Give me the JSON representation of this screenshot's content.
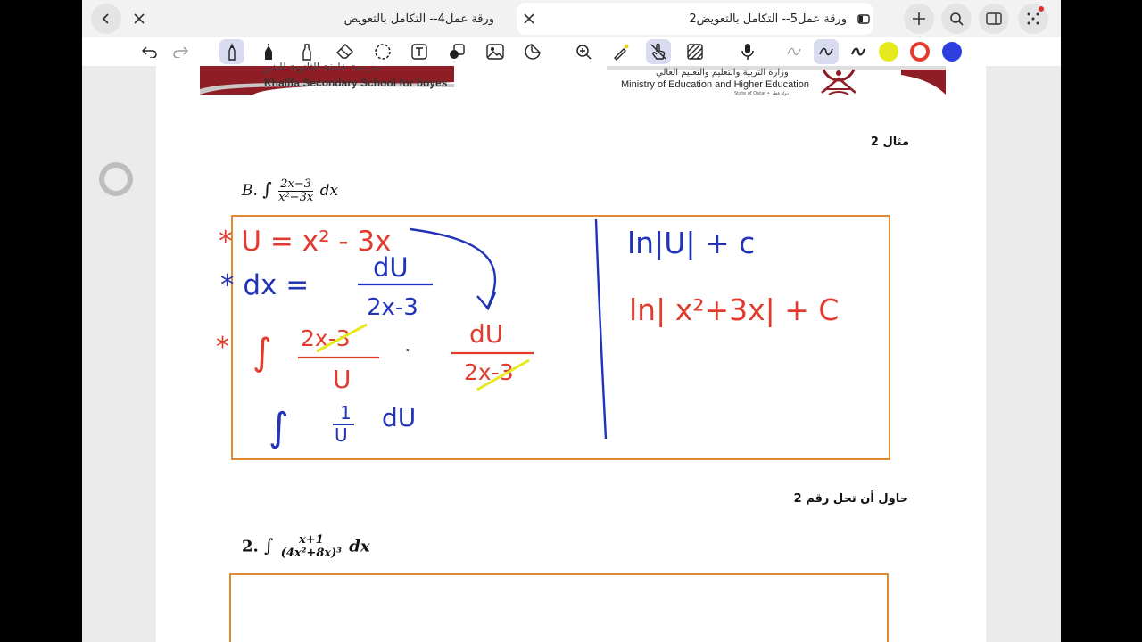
{
  "tabs": [
    {
      "title": "ورقة عمل4-- التكامل بالتعويض",
      "active": false
    },
    {
      "title": "ورقة عمل5-- التكامل بالتعويض2",
      "active": true
    }
  ],
  "icons": {
    "back": "chevron-left-icon",
    "new_tab": "plus-icon",
    "search": "search-icon",
    "sidebar": "sidebar-icon",
    "more": "grid-dots-icon",
    "undo": "undo-icon",
    "redo": "redo-icon",
    "pen": "pen-icon",
    "marker": "marker-icon",
    "highlighter": "highlighter-icon",
    "eraser": "eraser-icon",
    "lasso": "lasso-icon",
    "text": "text-box-icon",
    "shapes": "shapes-icon",
    "image": "image-icon",
    "sticker": "sticker-icon",
    "zoom": "zoom-icon",
    "laser": "laser-pointer-icon",
    "touch": "hand-touch-icon",
    "hatch": "hatch-icon",
    "mic": "microphone-icon"
  },
  "colors": {
    "yellow": "#e6ea1d",
    "red": "#e63a2e",
    "blue": "#2c3ee0",
    "ink_red": "#e23b2e",
    "ink_blue": "#2233b8",
    "box": "#e08a33"
  },
  "header": {
    "school_en": "Khalifa Secondary School for boyes",
    "school_ar": "مدرسة خليفة الثانوية للبنين",
    "ministry_ar": "وزارة التربية والتعليم والتعليم العالي",
    "ministry_en": "Ministry of Education and Higher Education",
    "state": "State of Qatar • دولة قطر"
  },
  "example": {
    "heading": "مثال 2",
    "label": "B.",
    "integral": "∫",
    "num": "2x−3",
    "den": "x²−3x",
    "dx": "dx"
  },
  "work": {
    "line1": "* U = x² - 3x",
    "line2_left": "* dx =",
    "line2_num": "dU",
    "line2_den": "2x-3",
    "line3_star": "*",
    "line3_int": "∫",
    "line3_num1": "2x-3",
    "line3_den1": "U",
    "line3_dot": "·",
    "line3_num2": "dU",
    "line3_den2": "2x-3",
    "line4_int": "∫",
    "line4_num": "1",
    "line4_den": "U",
    "line4_du": "dU",
    "result1": "ln|U| + c",
    "result2": "ln| x²+3x| + C"
  },
  "problem": {
    "heading": "حاول أن تحل رقم 2",
    "label": "2.",
    "integral": "∫",
    "num": "x+1",
    "den": "(4x²+8x)³",
    "dx": "dx"
  }
}
